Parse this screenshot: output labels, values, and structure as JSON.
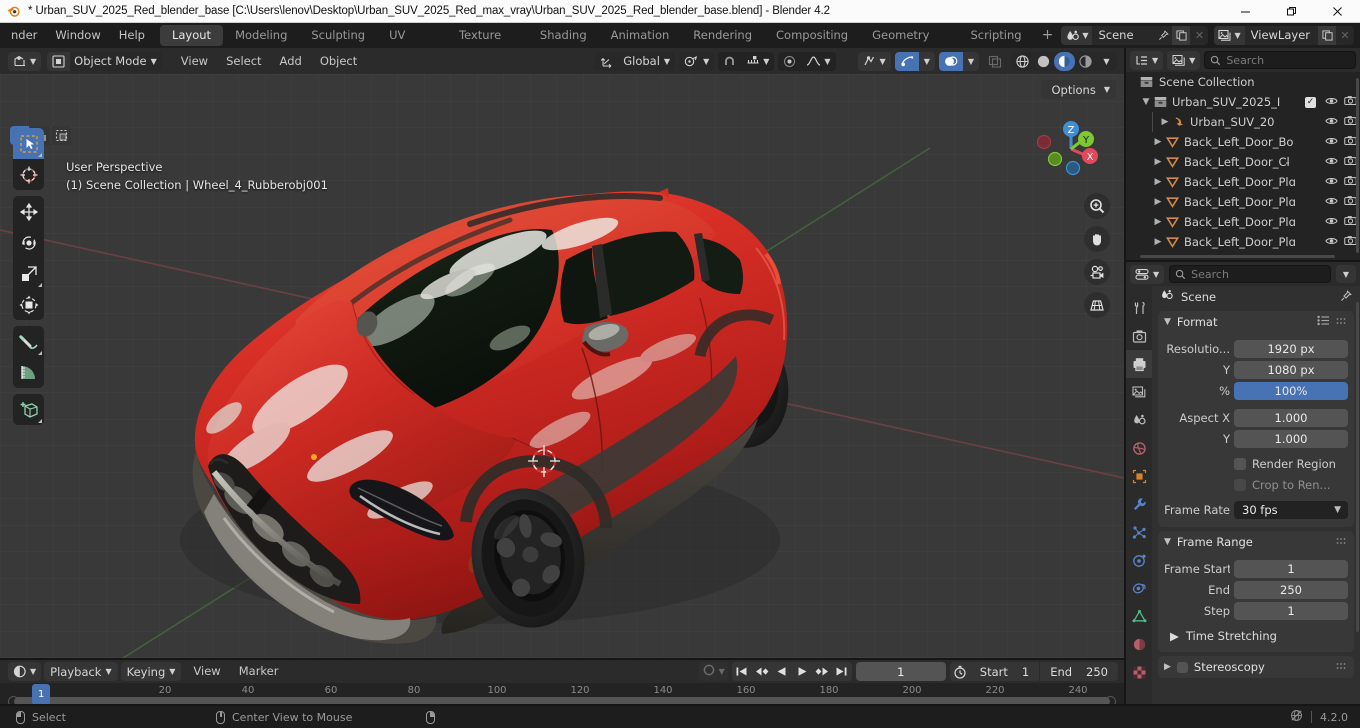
{
  "window": {
    "title": "* Urban_SUV_2025_Red_blender_base [C:\\Users\\lenov\\Desktop\\Urban_SUV_2025_Red_max_vray\\Urban_SUV_2025_Red_blender_base.blend] - Blender 4.2",
    "minimize": "–",
    "maximize": "❐",
    "close": "✕",
    "app_icon": "blender-logo-icon"
  },
  "topbar": {
    "menus": [
      "nder",
      "Window",
      "Help"
    ],
    "workspaces": [
      {
        "label": "Layout",
        "active": true
      },
      {
        "label": "Modeling",
        "active": false
      },
      {
        "label": "Sculpting",
        "active": false
      },
      {
        "label": "UV Editing",
        "active": false
      },
      {
        "label": "Texture Paint",
        "active": false
      },
      {
        "label": "Shading",
        "active": false
      },
      {
        "label": "Animation",
        "active": false
      },
      {
        "label": "Rendering",
        "active": false
      },
      {
        "label": "Compositing",
        "active": false
      },
      {
        "label": "Geometry Nodes",
        "active": false
      },
      {
        "label": "Scripting",
        "active": false
      }
    ],
    "add_workspace": "+",
    "scene": {
      "name": "Scene",
      "icon": "scene-icon",
      "pin": "pin-icon",
      "new": "duplicate-icon",
      "unlink": "✕"
    },
    "viewlayer": {
      "name": "ViewLayer",
      "icon": "viewlayer-icon",
      "new": "duplicate-icon",
      "unlink": "✕"
    }
  },
  "viewport": {
    "editor_type": "editor-type-3dview-icon",
    "mode": "Object Mode",
    "menus": [
      "View",
      "Select",
      "Add",
      "Object"
    ],
    "transform_orientation": "Global",
    "pivot": "pivot-point-icon",
    "snap": "snap-magnet-icon",
    "proportional": "proportional-edit-icon",
    "options_label": "Options",
    "overlay_line1": "User Perspective",
    "overlay_line2": "(1) Scene Collection | Wheel_4_Rubberobj001",
    "gizmo_axes": [
      {
        "label": "Z",
        "color": "#3f8fd4"
      },
      {
        "label": "Y",
        "color": "#7ec832"
      },
      {
        "label": "X",
        "color": "#e04a5b"
      }
    ],
    "nav_buttons": [
      "zoom-icon",
      "pan-hand-icon",
      "camera-view-icon",
      "toggle-perspective-icon"
    ],
    "select_modes": [
      "select-box-icon",
      "select-circle-icon",
      "select-lasso-icon"
    ],
    "tools": [
      "tweak-select-box-icon",
      "cursor-icon",
      "move-icon",
      "rotate-icon",
      "scale-icon",
      "transform-icon",
      "annotate-icon",
      "measure-icon",
      "add-cube-icon"
    ],
    "shading_modes": [
      "wireframe-icon",
      "solid-icon",
      "material-preview-icon",
      "rendered-icon"
    ],
    "shading_active": "material-preview-icon",
    "visibility_icons": [
      "show-gizmo-icon",
      "show-overlays-icon",
      "xray-toggle-icon"
    ]
  },
  "outliner": {
    "display_mode_icon": "outliner-display-mode-icon",
    "filter_icon": "outliner-filter-icon",
    "search_placeholder": "Search",
    "root": {
      "label": "Scene Collection",
      "icon": "collection-icon"
    },
    "items": [
      {
        "label": "Urban_SUV_2025_I",
        "icon": "collection-icon",
        "indent": 1,
        "expanded": true,
        "checkbox": true,
        "eye": true,
        "camera": true
      },
      {
        "label": "Urban_SUV_20",
        "icon": "armature-icon",
        "indent": 2,
        "expanded": false,
        "checkbox": false,
        "eye": true,
        "camera": true
      },
      {
        "label": "Back_Left_Door_Bo",
        "icon": "mesh-icon",
        "indent": 2,
        "expanded": false,
        "checkbox": false,
        "eye": true,
        "camera": true
      },
      {
        "label": "Back_Left_Door_Cl̵",
        "icon": "mesh-icon",
        "indent": 2,
        "expanded": false,
        "checkbox": false,
        "eye": true,
        "camera": true
      },
      {
        "label": "Back_Left_Door_Plɑ",
        "icon": "mesh-icon",
        "indent": 2,
        "expanded": false,
        "checkbox": false,
        "eye": true,
        "camera": true
      },
      {
        "label": "Back_Left_Door_Plɑ",
        "icon": "mesh-icon",
        "indent": 2,
        "expanded": false,
        "checkbox": false,
        "eye": true,
        "camera": true
      },
      {
        "label": "Back_Left_Door_Plɑ",
        "icon": "mesh-icon",
        "indent": 2,
        "expanded": false,
        "checkbox": false,
        "eye": true,
        "camera": true
      },
      {
        "label": "Back_Left_Door_Plɑ",
        "icon": "mesh-icon",
        "indent": 2,
        "expanded": false,
        "checkbox": false,
        "eye": true,
        "camera": true
      }
    ]
  },
  "properties": {
    "editor_type_icon": "editor-type-properties-icon",
    "search_placeholder": "Search",
    "breadcrumb": "Scene",
    "breadcrumb_icon": "scene-icon",
    "pin_icon": "pin-icon",
    "tabs": [
      {
        "name": "tool",
        "icon": "tool-icon",
        "active": false
      },
      {
        "name": "render",
        "icon": "render-icon",
        "active": false
      },
      {
        "name": "output",
        "icon": "output-printer-icon",
        "active": true
      },
      {
        "name": "view-layer",
        "icon": "view-layer-images-icon",
        "active": false
      },
      {
        "name": "scene",
        "icon": "scene-cone-icon",
        "active": false
      },
      {
        "name": "world",
        "icon": "world-globe-icon",
        "active": false
      },
      {
        "name": "object",
        "icon": "object-square-icon",
        "active": false
      },
      {
        "name": "modifiers",
        "icon": "wrench-icon",
        "active": false
      },
      {
        "name": "particles",
        "icon": "particles-icon",
        "active": false
      },
      {
        "name": "physics",
        "icon": "physics-orbit-icon",
        "active": false
      },
      {
        "name": "constraints",
        "icon": "constraint-icon",
        "active": false
      },
      {
        "name": "data",
        "icon": "mesh-data-icon",
        "active": false
      },
      {
        "name": "material",
        "icon": "material-sphere-icon",
        "active": false
      },
      {
        "name": "texture",
        "icon": "texture-checker-icon",
        "active": false
      }
    ],
    "format_panel": {
      "title": "Format",
      "expanded": true,
      "rows": [
        {
          "label": "Resolutio...",
          "value": "1920 px",
          "style": "normal"
        },
        {
          "label": "Y",
          "value": "1080 px",
          "style": "normal"
        },
        {
          "label": "%",
          "value": "100%",
          "style": "blue"
        },
        {
          "label": "Aspect X",
          "value": "1.000",
          "style": "normal"
        },
        {
          "label": "Y",
          "value": "1.000",
          "style": "normal"
        }
      ],
      "checkboxes": [
        {
          "label": "Render Region",
          "checked": false,
          "dim": false
        },
        {
          "label": "Crop to Ren...",
          "checked": false,
          "dim": true
        }
      ],
      "frame_rate_label": "Frame Rate",
      "frame_rate_value": "30 fps"
    },
    "frame_range_panel": {
      "title": "Frame Range",
      "expanded": true,
      "rows": [
        {
          "label": "Frame Start",
          "value": "1"
        },
        {
          "label": "End",
          "value": "250"
        },
        {
          "label": "Step",
          "value": "1"
        }
      ],
      "sub": "Time Stretching"
    },
    "stereoscopy_panel": {
      "title": "Stereoscopy",
      "expanded": false,
      "checked": false
    }
  },
  "timeline": {
    "editor_type_icon": "editor-type-timeline-icon",
    "menus_dropdowns": [
      "Playback",
      "Keying"
    ],
    "menus": [
      "View",
      "Marker"
    ],
    "auto_key_icon": "record-circle-icon",
    "playback_buttons": [
      "jump-to-start-icon",
      "prev-keyframe-icon",
      "play-reverse-icon",
      "play-icon",
      "next-keyframe-icon",
      "jump-to-end-icon"
    ],
    "current_frame": "1",
    "use_preview_icon": "stopwatch-icon",
    "start_label": "Start",
    "start_value": "1",
    "end_label": "End",
    "end_value": "250",
    "ruler_ticks": [
      "20",
      "40",
      "60",
      "80",
      "100",
      "120",
      "140",
      "160",
      "180",
      "200",
      "220",
      "240"
    ],
    "playhead_label": "1"
  },
  "statusbar": {
    "items": [
      {
        "icon": "mouse-left-icon",
        "label": "Select"
      },
      {
        "icon": "mouse-middle-icon",
        "label": "Center View to Mouse"
      },
      {
        "icon": "mouse-right-icon",
        "label": ""
      }
    ],
    "version": "4.2.0",
    "status_icon": "no-network-icon"
  },
  "colors": {
    "accent_blue": "#4772b3",
    "panel_bg": "#303030",
    "header_bg": "#2b2b2b",
    "editor_bg": "#232323",
    "viewport_bg": "#393939",
    "text": "#d2d2d2"
  }
}
